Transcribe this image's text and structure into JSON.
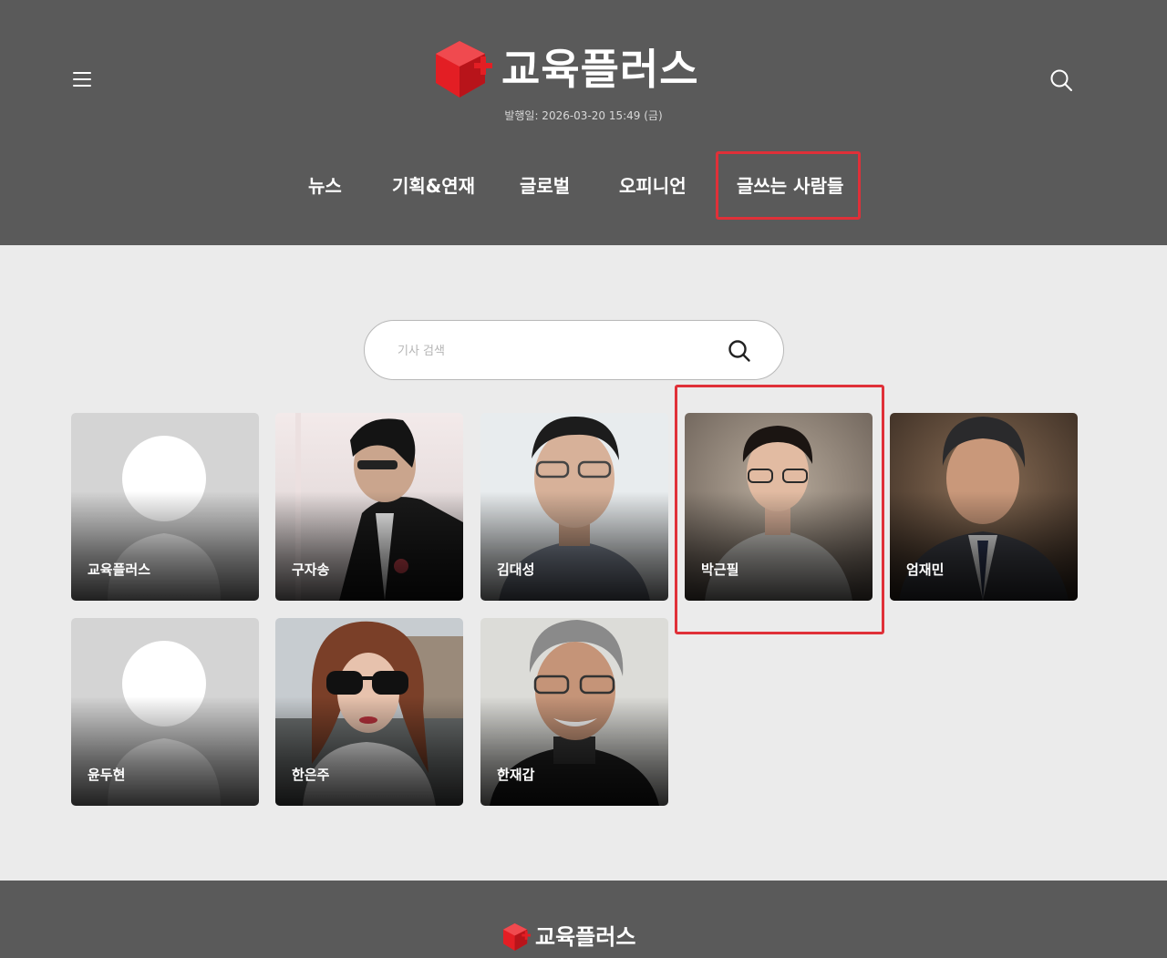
{
  "site": {
    "logo_text": "교육플러스",
    "pubdate": "발행일: 2026-03-20 15:49 (금)",
    "brand_color": "#e31e24"
  },
  "nav": [
    {
      "label": "뉴스"
    },
    {
      "label": "기획&연재"
    },
    {
      "label": "글로벌"
    },
    {
      "label": "오피니언"
    },
    {
      "label": "글쓰는 사람들"
    }
  ],
  "search": {
    "placeholder": "기사 검색",
    "icon": "search-icon"
  },
  "writers": [
    {
      "name": "교육플러스",
      "photo": "default-avatar"
    },
    {
      "name": "구자송",
      "photo": "photo"
    },
    {
      "name": "김대성",
      "photo": "photo"
    },
    {
      "name": "박근필",
      "photo": "photo"
    },
    {
      "name": "엄재민",
      "photo": "photo"
    },
    {
      "name": "윤두현",
      "photo": "default-avatar"
    },
    {
      "name": "한은주",
      "photo": "photo"
    },
    {
      "name": "한재갑",
      "photo": "photo"
    }
  ],
  "footer": {
    "logo_text": "교육플러스"
  }
}
